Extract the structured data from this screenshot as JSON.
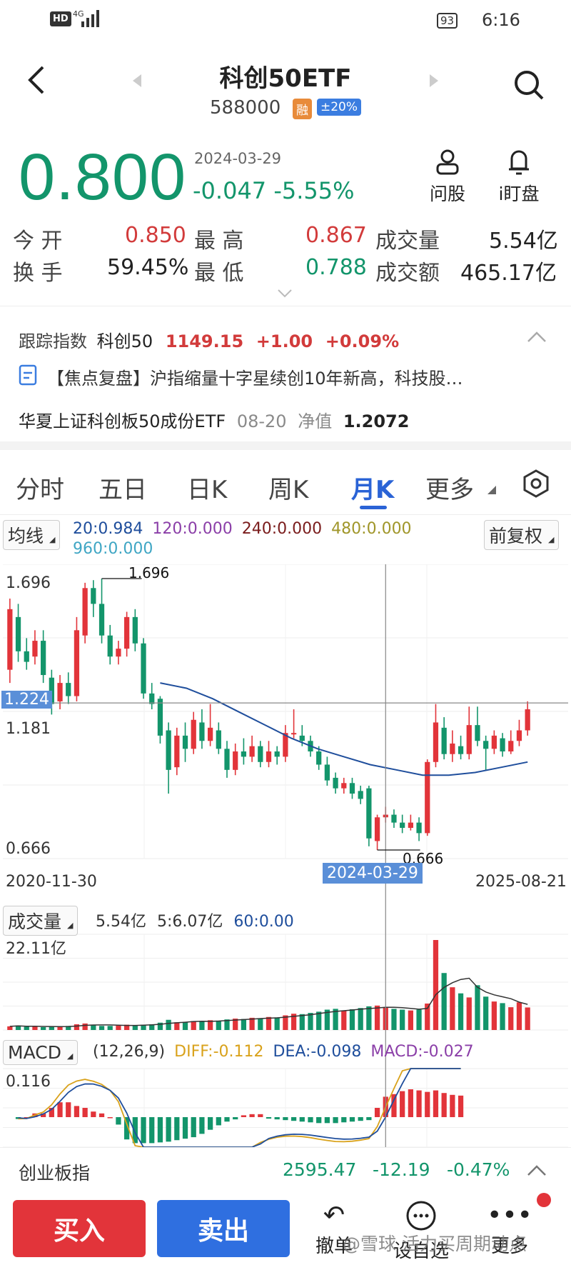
{
  "status_bar": {
    "hd": "HD",
    "net": "4G",
    "battery": "93",
    "time": "6:16"
  },
  "header": {
    "title": "科创50ETF",
    "code": "588000",
    "badge_margin": "融",
    "badge_limit": "±20%"
  },
  "quote": {
    "price": "0.800",
    "date": "2024-03-29",
    "change": "-0.047 -5.55%",
    "ask_label": "问股",
    "watch_label": "i盯盘"
  },
  "stats": {
    "open_label": "今  开",
    "open": "0.850",
    "high_label": "最  高",
    "high": "0.867",
    "vol_label": "成交量",
    "vol": "5.54亿",
    "turnover_label": "换  手",
    "turnover": "59.45%",
    "low_label": "最  低",
    "low": "0.788",
    "amount_label": "成交额",
    "amount": "465.17亿"
  },
  "tracking": {
    "label": "跟踪指数",
    "index": "科创50",
    "value": "1149.15",
    "change": "+1.00",
    "pct": "+0.09%"
  },
  "news": {
    "text": "【焦点复盘】沪指缩量十字星续创10年新高，科技股…"
  },
  "fund": {
    "name": "华夏上证科创板50成份ETF",
    "date": "08-20",
    "nav_label": "净值",
    "nav": "1.2072"
  },
  "tabs": [
    "分时",
    "五日",
    "日K",
    "周K",
    "月K",
    "更多"
  ],
  "active_tab": "月K",
  "ma": {
    "chip": "均线",
    "ma20": "20:0.984",
    "ma120": "120:0.000",
    "ma240": "240:0.000",
    "ma480": "480:0.000",
    "ma960": "960:0.000",
    "adjust": "前复权"
  },
  "kline": {
    "high_label": "1.696",
    "high_marker": "1.696",
    "crosshair_price": "1.224",
    "mid_label": "1.181",
    "low_label": "0.666",
    "low_marker": "0.666",
    "start_date": "2020-11-30",
    "cross_date": "2024-03-29",
    "end_date": "2025-08-21"
  },
  "volume": {
    "chip": "成交量",
    "current": "5.54亿",
    "ma5": "5:6.07亿",
    "ma60": "60:0.00",
    "max_label": "22.11亿"
  },
  "macd": {
    "chip": "MACD",
    "params": "(12,26,9)",
    "diff": "DIFF:-0.112",
    "dea": "DEA:-0.098",
    "macd": "MACD:-0.027",
    "top_label": "0.116"
  },
  "index_bar": {
    "name": "创业板指",
    "value": "2595.47",
    "change": "-12.19",
    "pct": "-0.47%"
  },
  "bottom": {
    "buy": "买入",
    "sell": "卖出",
    "undo": "撤单",
    "watch": "设自选",
    "more": "更多"
  },
  "watermark": "@雪球 活力买周期动点",
  "colors": {
    "up": "#e2343a",
    "down": "#13956b",
    "accent": "#2a63d6",
    "ma20": "#1f4e9c"
  },
  "chart_data": {
    "type": "candlestick",
    "x_range": [
      "2020-11-30",
      "2025-08-21"
    ],
    "y_range": [
      0.666,
      1.696
    ],
    "candles": [
      {
        "o": 1.35,
        "c": 1.58,
        "h": 1.62,
        "l": 1.3
      },
      {
        "o": 1.55,
        "c": 1.42,
        "h": 1.6,
        "l": 1.38
      },
      {
        "o": 1.42,
        "c": 1.38,
        "h": 1.47,
        "l": 1.35
      },
      {
        "o": 1.4,
        "c": 1.46,
        "h": 1.5,
        "l": 1.37
      },
      {
        "o": 1.46,
        "c": 1.33,
        "h": 1.5,
        "l": 1.3
      },
      {
        "o": 1.32,
        "c": 1.22,
        "h": 1.35,
        "l": 1.18
      },
      {
        "o": 1.23,
        "c": 1.3,
        "h": 1.33,
        "l": 1.2
      },
      {
        "o": 1.3,
        "c": 1.25,
        "h": 1.34,
        "l": 1.22
      },
      {
        "o": 1.25,
        "c": 1.5,
        "h": 1.55,
        "l": 1.23
      },
      {
        "o": 1.48,
        "c": 1.66,
        "h": 1.68,
        "l": 1.45
      },
      {
        "o": 1.66,
        "c": 1.6,
        "h": 1.69,
        "l": 1.55
      },
      {
        "o": 1.6,
        "c": 1.48,
        "h": 1.696,
        "l": 1.45
      },
      {
        "o": 1.48,
        "c": 1.4,
        "h": 1.52,
        "l": 1.37
      },
      {
        "o": 1.4,
        "c": 1.43,
        "h": 1.46,
        "l": 1.37
      },
      {
        "o": 1.43,
        "c": 1.55,
        "h": 1.57,
        "l": 1.4
      },
      {
        "o": 1.55,
        "c": 1.45,
        "h": 1.58,
        "l": 1.42
      },
      {
        "o": 1.45,
        "c": 1.26,
        "h": 1.47,
        "l": 1.24
      },
      {
        "o": 1.26,
        "c": 1.22,
        "h": 1.3,
        "l": 1.2
      },
      {
        "o": 1.24,
        "c": 1.1,
        "h": 1.25,
        "l": 1.07
      },
      {
        "o": 1.12,
        "c": 0.97,
        "h": 1.15,
        "l": 0.88
      },
      {
        "o": 0.98,
        "c": 1.1,
        "h": 1.13,
        "l": 0.95
      },
      {
        "o": 1.1,
        "c": 1.05,
        "h": 1.15,
        "l": 1.0
      },
      {
        "o": 1.05,
        "c": 1.16,
        "h": 1.19,
        "l": 1.03
      },
      {
        "o": 1.15,
        "c": 1.08,
        "h": 1.2,
        "l": 1.05
      },
      {
        "o": 1.08,
        "c": 1.13,
        "h": 1.22,
        "l": 1.06
      },
      {
        "o": 1.12,
        "c": 1.05,
        "h": 1.15,
        "l": 1.03
      },
      {
        "o": 1.05,
        "c": 0.97,
        "h": 1.08,
        "l": 0.94
      },
      {
        "o": 0.97,
        "c": 1.04,
        "h": 1.07,
        "l": 0.95
      },
      {
        "o": 1.04,
        "c": 1.02,
        "h": 1.09,
        "l": 0.99
      },
      {
        "o": 1.02,
        "c": 1.06,
        "h": 1.1,
        "l": 1.0
      },
      {
        "o": 1.06,
        "c": 1.0,
        "h": 1.08,
        "l": 0.98
      },
      {
        "o": 1.0,
        "c": 1.04,
        "h": 1.08,
        "l": 0.98
      },
      {
        "o": 1.04,
        "c": 1.02,
        "h": 1.06,
        "l": 0.99
      },
      {
        "o": 1.02,
        "c": 1.11,
        "h": 1.14,
        "l": 1.0
      },
      {
        "o": 1.11,
        "c": 1.11,
        "h": 1.2,
        "l": 1.09
      },
      {
        "o": 1.1,
        "c": 1.08,
        "h": 1.14,
        "l": 1.06
      },
      {
        "o": 1.08,
        "c": 1.04,
        "h": 1.1,
        "l": 1.02
      },
      {
        "o": 1.04,
        "c": 0.99,
        "h": 1.06,
        "l": 0.97
      },
      {
        "o": 0.99,
        "c": 0.93,
        "h": 1.02,
        "l": 0.91
      },
      {
        "o": 0.94,
        "c": 0.9,
        "h": 0.96,
        "l": 0.88
      },
      {
        "o": 0.9,
        "c": 0.92,
        "h": 0.94,
        "l": 0.88
      },
      {
        "o": 0.92,
        "c": 0.88,
        "h": 0.94,
        "l": 0.86
      },
      {
        "o": 0.89,
        "c": 0.86,
        "h": 0.91,
        "l": 0.84
      },
      {
        "o": 0.9,
        "c": 0.71,
        "h": 0.91,
        "l": 0.68
      },
      {
        "o": 0.7,
        "c": 0.79,
        "h": 0.8,
        "l": 0.666
      },
      {
        "o": 0.79,
        "c": 0.8,
        "h": 0.83,
        "l": 0.77
      },
      {
        "o": 0.8,
        "c": 0.77,
        "h": 0.82,
        "l": 0.75
      },
      {
        "o": 0.77,
        "c": 0.75,
        "h": 0.8,
        "l": 0.73
      },
      {
        "o": 0.75,
        "c": 0.77,
        "h": 0.8,
        "l": 0.74
      },
      {
        "o": 0.77,
        "c": 0.73,
        "h": 0.79,
        "l": 0.7
      },
      {
        "o": 0.73,
        "c": 1.0,
        "h": 1.01,
        "l": 0.72
      },
      {
        "o": 1.0,
        "c": 1.15,
        "h": 1.22,
        "l": 0.98
      },
      {
        "o": 1.13,
        "c": 1.03,
        "h": 1.17,
        "l": 1.01
      },
      {
        "o": 1.03,
        "c": 1.07,
        "h": 1.12,
        "l": 1.0
      },
      {
        "o": 1.06,
        "c": 1.03,
        "h": 1.1,
        "l": 1.01
      },
      {
        "o": 1.03,
        "c": 1.14,
        "h": 1.21,
        "l": 1.01
      },
      {
        "o": 1.14,
        "c": 1.08,
        "h": 1.21,
        "l": 1.06
      },
      {
        "o": 1.08,
        "c": 1.05,
        "h": 1.1,
        "l": 0.97
      },
      {
        "o": 1.05,
        "c": 1.1,
        "h": 1.12,
        "l": 1.03
      },
      {
        "o": 1.09,
        "c": 1.04,
        "h": 1.11,
        "l": 1.02
      },
      {
        "o": 1.04,
        "c": 1.08,
        "h": 1.12,
        "l": 1.03
      },
      {
        "o": 1.08,
        "c": 1.12,
        "h": 1.16,
        "l": 1.06
      },
      {
        "o": 1.12,
        "c": 1.2,
        "h": 1.23,
        "l": 1.1
      }
    ],
    "ma20_series": [
      1.3,
      1.28,
      1.24,
      1.19,
      1.14,
      1.09,
      1.05,
      1.02,
      0.99,
      0.97,
      0.95,
      0.95,
      0.96,
      0.98,
      1.0
    ],
    "volume": [
      0.9,
      1.1,
      0.8,
      0.9,
      0.7,
      0.8,
      0.9,
      1.0,
      1.4,
      1.6,
      1.2,
      1.0,
      1.0,
      1.1,
      1.3,
      1.2,
      1.3,
      1.4,
      1.8,
      2.5,
      1.9,
      2.0,
      2.2,
      2.1,
      2.4,
      2.3,
      2.6,
      2.8,
      2.7,
      3.0,
      2.9,
      3.2,
      3.1,
      3.6,
      4.0,
      3.9,
      4.2,
      4.5,
      5.0,
      5.2,
      4.8,
      5.1,
      5.4,
      5.8,
      6.0,
      5.5,
      5.2,
      5.0,
      4.8,
      5.0,
      6.5,
      22.11,
      14.0,
      10.5,
      9.0,
      8.0,
      11.0,
      8.2,
      7.0,
      6.6,
      5.6,
      6.8,
      5.54
    ],
    "macd_hist": [
      -0.005,
      0.0,
      0.01,
      0.01,
      0.025,
      0.04,
      0.04,
      0.03,
      0.025,
      0.015,
      0.01,
      0.0,
      -0.02,
      -0.06,
      -0.07,
      -0.07,
      -0.07,
      -0.068,
      -0.066,
      -0.062,
      -0.058,
      -0.054,
      -0.045,
      -0.034,
      -0.022,
      -0.012,
      -0.006,
      0.005,
      0.008,
      0.008,
      -0.004,
      -0.006,
      -0.008,
      -0.01,
      -0.012,
      -0.014,
      -0.016,
      -0.016,
      -0.016,
      -0.014,
      -0.012,
      -0.01,
      -0.008,
      0.025,
      0.055,
      0.062,
      0.07,
      0.075,
      0.072,
      0.068,
      0.072,
      0.065,
      0.06,
      0.058
    ]
  }
}
